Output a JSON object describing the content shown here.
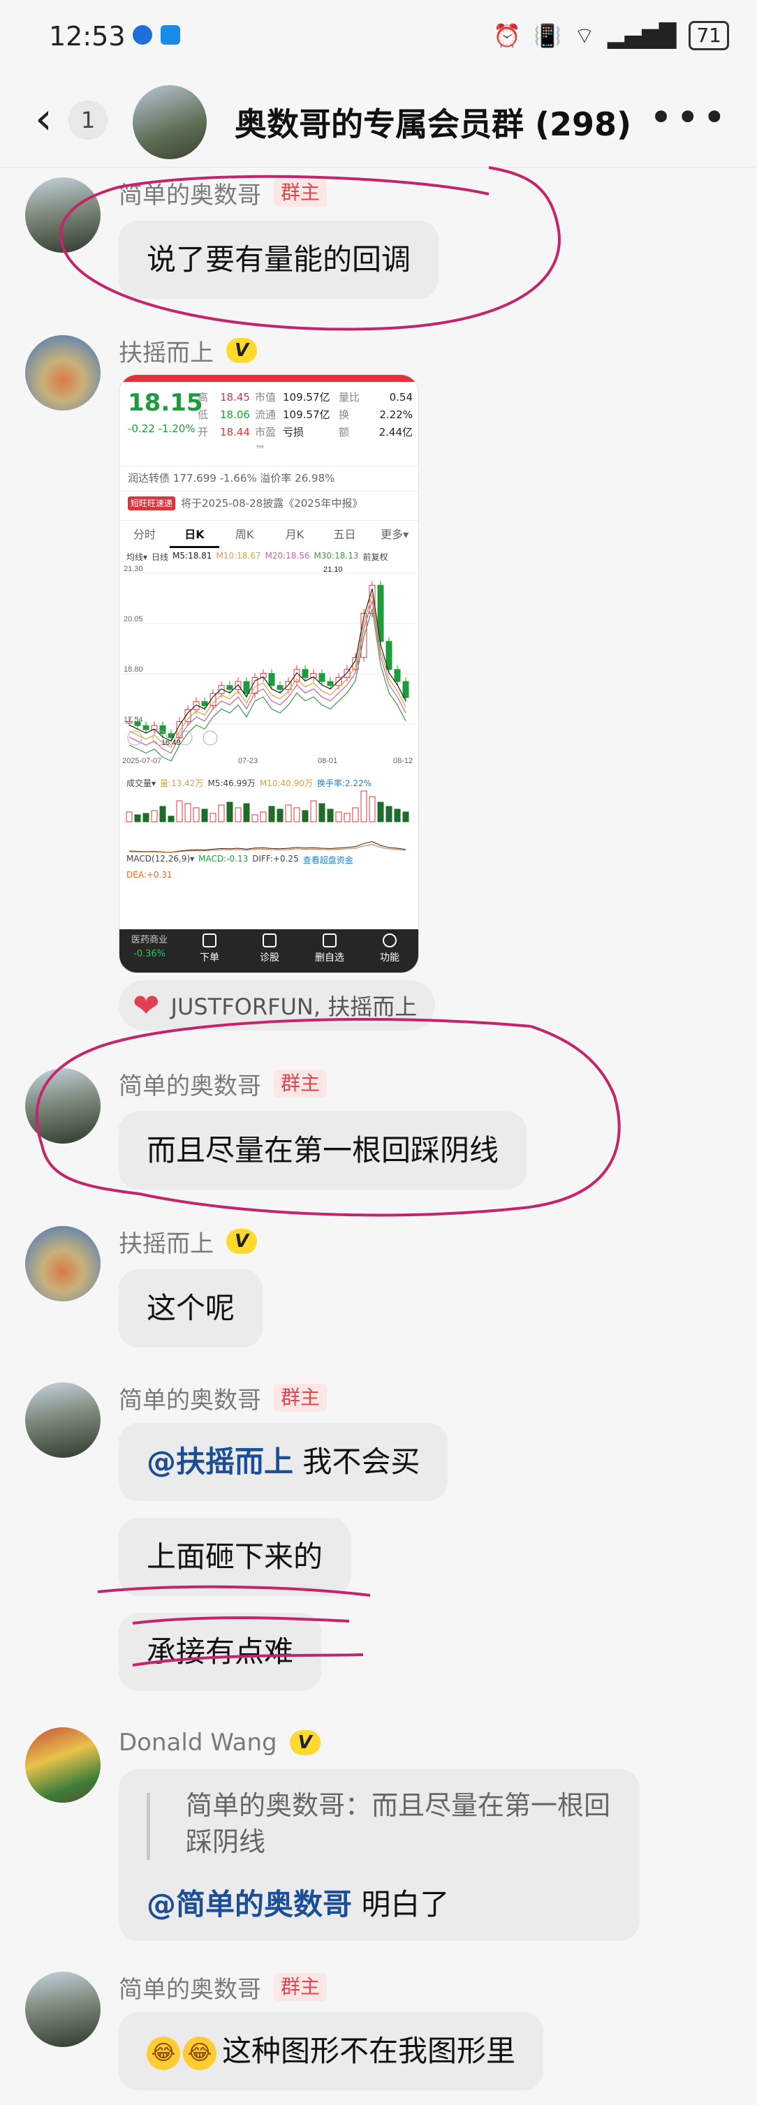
{
  "status": {
    "time": "12:53",
    "battery": "71"
  },
  "header": {
    "unread_count": "1",
    "title": "奥数哥的专属会员群 (298)",
    "more_label": "•••"
  },
  "messages": [
    {
      "sender": "简单的奥数哥",
      "role": "群主",
      "text": "说了要有量能的回调"
    },
    {
      "sender": "扶摇而上",
      "badge": "V"
    },
    {
      "sender": "简单的奥数哥",
      "role": "群主",
      "text": "而且尽量在第一根回踩阴线"
    },
    {
      "sender": "扶摇而上",
      "badge": "V",
      "text": "这个呢"
    },
    {
      "sender": "简单的奥数哥",
      "role": "群主",
      "mention": "@扶摇而上",
      "text": " 我不会买",
      "text2": "上面砸下来的",
      "text3": "承接有点难"
    },
    {
      "sender": "Donald Wang",
      "badge": "V",
      "quote": "简单的奥数哥：而且尽量在第一根回踩阴线",
      "mention": "@简单的奥数哥",
      "text": " 明白了"
    },
    {
      "sender": "简单的奥数哥",
      "role": "群主",
      "text": "这种图形不在我图形里"
    }
  ],
  "reaction": {
    "icon": "heart-icon",
    "users": "JUSTFORFUN, 扶摇而上"
  },
  "stock": {
    "price": "18.15",
    "change": "-0.22  -1.20%",
    "quote_rows": [
      {
        "l1": "高",
        "v1": "18.45",
        "l2": "市值",
        "v2": "109.57亿",
        "l3": "量比",
        "v3": "0.54"
      },
      {
        "l1": "低",
        "v1": "18.06",
        "l2": "流通",
        "v2": "109.57亿",
        "l3": "换",
        "v3": "2.22%"
      },
      {
        "l1": "开",
        "v1": "18.44",
        "l2": "市盈™",
        "v2": "亏损",
        "l3": "额",
        "v3": "2.44亿"
      }
    ],
    "convert_line": "润达转债  177.699  -1.66%    溢价率  26.98%",
    "notice_tag": "短旺旺速递",
    "notice": "将于2025-08-28披露《2025年中报》",
    "tabs": [
      "分时",
      "日K",
      "周K",
      "月K",
      "五日",
      "更多▾"
    ],
    "k_info": {
      "type": "均线▾",
      "period": "日线",
      "ma5": "M5:18.81",
      "ma10": "M10:18.67",
      "ma20": "M20:18.56",
      "ma30": "M30:18.13",
      "adj": "前复权"
    },
    "y_labels": [
      "21.30",
      "20.05",
      "18.80",
      "17.54"
    ],
    "high_mark": "21.10",
    "low_mark": "16.49",
    "dates": [
      "2025-07-07",
      "07-23",
      "08-01",
      "08-12"
    ],
    "vol_info": {
      "label": "成交量▾",
      "vol": "量:13.42万",
      "m5": "M5:46.99万",
      "m10": "M10:40.90万",
      "turnover": "换手率:2.22%"
    },
    "macd_info": {
      "label": "MACD(12,26,9)▾",
      "macd": "MACD:-0.13",
      "diff": "DIFF:+0.25",
      "link": "查看超盘资金",
      "dea": "DEA:+0.31"
    },
    "nav": [
      {
        "label": "医药商业",
        "sub": "-0.36%"
      },
      {
        "label": "下单"
      },
      {
        "label": "诊股"
      },
      {
        "label": "删自选"
      },
      {
        "label": "功能"
      }
    ]
  }
}
